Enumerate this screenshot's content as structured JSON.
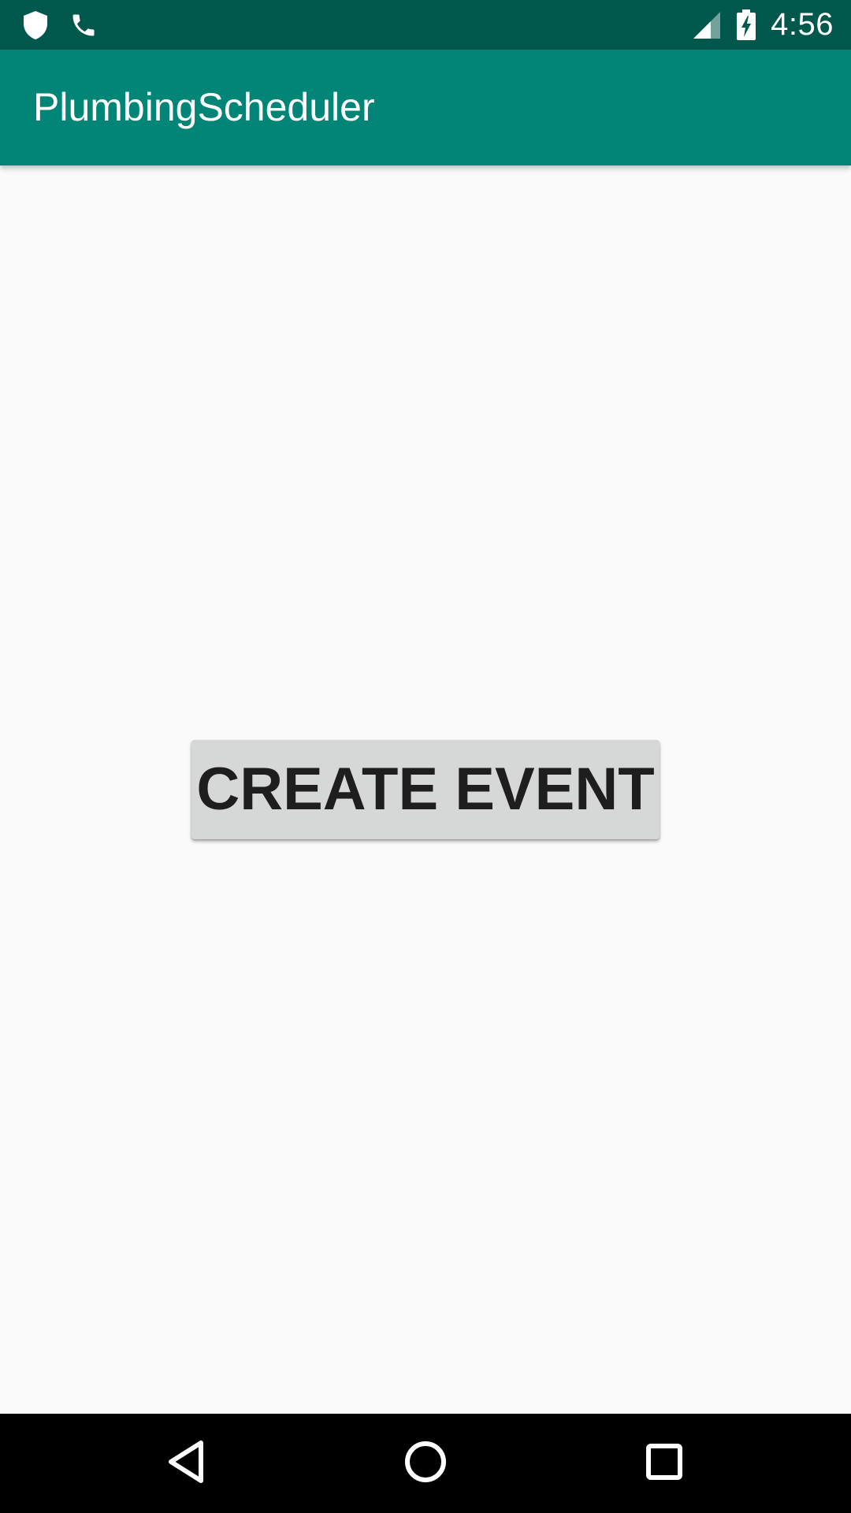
{
  "status_bar": {
    "time": "4:56",
    "left_icons": [
      "shield-icon",
      "phone-icon"
    ],
    "right_icons": [
      "signal-icon",
      "battery-charging-icon"
    ],
    "background_color": "#00574b"
  },
  "app_bar": {
    "title": "PlumbingScheduler",
    "background_color": "#008577"
  },
  "main": {
    "create_event_label": "CREATE EVENT"
  },
  "nav_bar": {
    "buttons": [
      "back-icon",
      "home-icon",
      "recents-icon"
    ],
    "background_color": "#000000"
  }
}
